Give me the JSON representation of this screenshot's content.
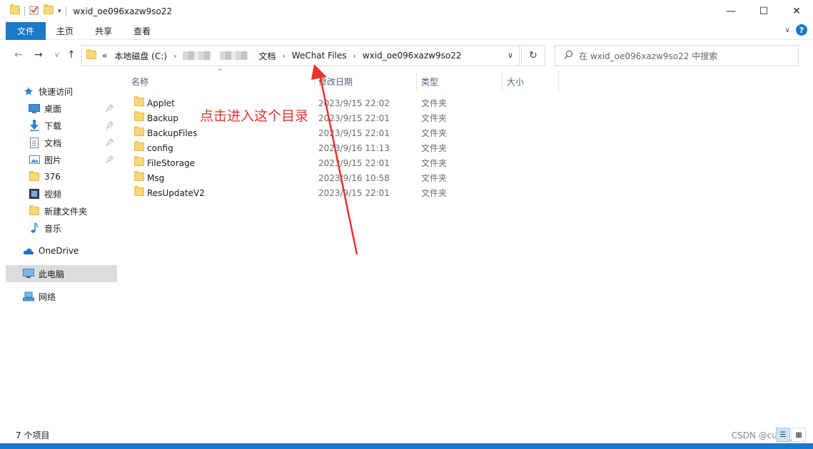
{
  "window": {
    "title": "wxid_oe096xazw9so22",
    "minimize": "—",
    "maximize": "☐",
    "close": "✕"
  },
  "ribbon": {
    "tabs": [
      "文件",
      "主页",
      "共享",
      "查看"
    ],
    "expand": "∨",
    "help": "?"
  },
  "address": {
    "overflow": "«",
    "segments": [
      "本地磁盘 (C:)",
      "文档",
      "WeChat Files",
      "wxid_oe096xazw9so22"
    ],
    "separator": "›",
    "dropdown": "∨",
    "refresh": "↻"
  },
  "search": {
    "placeholder": "在 wxid_oe096xazw9so22 中搜索"
  },
  "nav_buttons": {
    "back": "←",
    "forward": "→",
    "recent": "∨",
    "up": "↑"
  },
  "sidebar": {
    "quick_access": "快速访问",
    "items": [
      {
        "label": "桌面",
        "pinned": true
      },
      {
        "label": "下载",
        "pinned": true
      },
      {
        "label": "文档",
        "pinned": true
      },
      {
        "label": "图片",
        "pinned": true
      },
      {
        "label": "376",
        "pinned": false
      },
      {
        "label": "视频",
        "pinned": false
      },
      {
        "label": "新建文件夹",
        "pinned": false
      },
      {
        "label": "音乐",
        "pinned": false
      }
    ],
    "onedrive": "OneDrive",
    "this_pc": "此电脑",
    "network": "网络"
  },
  "columns": {
    "name": "名称",
    "date": "修改日期",
    "type": "类型",
    "size": "大小"
  },
  "files": [
    {
      "name": "Applet",
      "date": "2023/9/15 22:02",
      "type": "文件夹"
    },
    {
      "name": "Backup",
      "date": "2023/9/15 22:01",
      "type": "文件夹"
    },
    {
      "name": "BackupFiles",
      "date": "2023/9/15 22:01",
      "type": "文件夹"
    },
    {
      "name": "config",
      "date": "2023/9/16 11:13",
      "type": "文件夹"
    },
    {
      "name": "FileStorage",
      "date": "2023/9/15 22:01",
      "type": "文件夹"
    },
    {
      "name": "Msg",
      "date": "2023/9/16 10:58",
      "type": "文件夹"
    },
    {
      "name": "ResUpdateV2",
      "date": "2023/9/15 22:01",
      "type": "文件夹"
    }
  ],
  "status": {
    "count": "7 个项目"
  },
  "annotation": {
    "text": "点击进入这个目录"
  },
  "watermark": "CSDN @cuny_wu",
  "colors": {
    "accent": "#1979ca",
    "annotation": "#e8332c",
    "folder": "#f8d775"
  }
}
